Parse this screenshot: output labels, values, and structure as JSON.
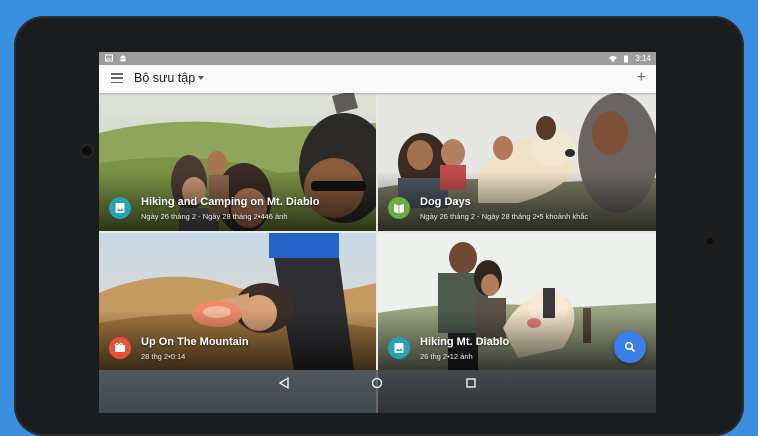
{
  "app": {
    "title": "Bộ sưu tập"
  },
  "status_bar": {
    "time": "3:14"
  },
  "albums": [
    {
      "title": "Hiking and Camping on Mt. Diablo",
      "subtitle": "Ngày 26 tháng 2 - Ngày 28 tháng 2•446 ảnh",
      "badge_color": "#26a3b8",
      "badge_icon": "photo-album-icon"
    },
    {
      "title": "Dog Days",
      "subtitle": "Ngày 26 tháng 2 - Ngày 28 tháng 2•5 khoảnh khắc",
      "badge_color": "#6aae3f",
      "badge_icon": "book-icon"
    },
    {
      "title": "Up On The Mountain",
      "subtitle": "28 thg 2•0:14",
      "badge_color": "#e8503a",
      "badge_icon": "movie-icon"
    },
    {
      "title": "Hiking Mt. Diablo",
      "subtitle": "26 thg 2•12 ảnh",
      "badge_color": "#26a3b8",
      "badge_icon": "photo-album-icon"
    }
  ],
  "colors": {
    "background": "#3a8fe0",
    "fab": "#3d7fe6",
    "status_bar": "#9e9e9e"
  }
}
